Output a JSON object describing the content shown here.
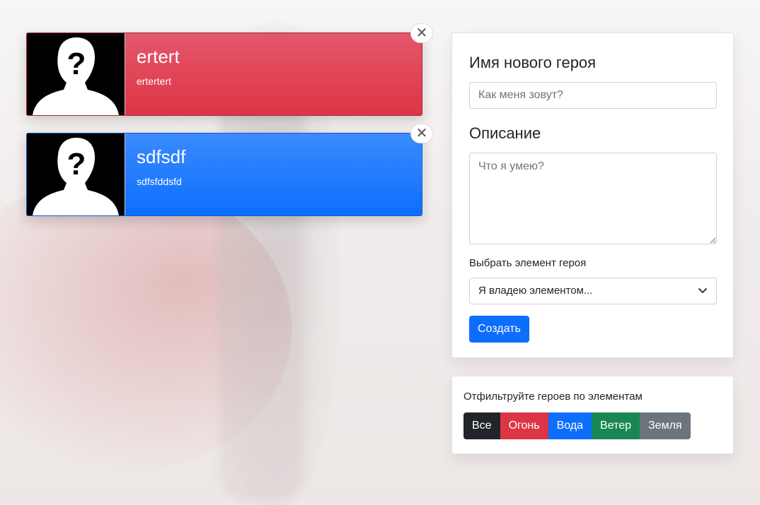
{
  "heroes": [
    {
      "name": "ertert",
      "description": "ertertert",
      "element_color": "#dc3545"
    },
    {
      "name": "sdfsdf",
      "description": "sdfsfddsfd",
      "element_color": "#0d6efd"
    }
  ],
  "close_icon": "close-icon",
  "form": {
    "name_heading": "Имя нового героя",
    "name_placeholder": "Как меня зовут?",
    "description_heading": "Описание",
    "description_placeholder": "Что я умею?",
    "element_label": "Выбрать элемент героя",
    "element_selected": "Я владею элементом...",
    "create_label": "Создать"
  },
  "filter": {
    "title": "Отфильтруйте героев по элементам",
    "buttons": [
      {
        "label": "Все",
        "color": "#212529"
      },
      {
        "label": "Огонь",
        "color": "#dc3545"
      },
      {
        "label": "Вода",
        "color": "#0d6efd"
      },
      {
        "label": "Ветер",
        "color": "#198754"
      },
      {
        "label": "Земля",
        "color": "#6c757d"
      }
    ]
  }
}
